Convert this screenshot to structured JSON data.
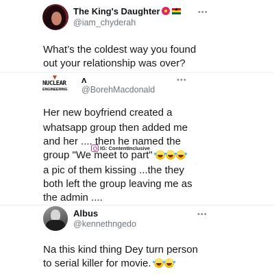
{
  "tweets": [
    {
      "name": "The King's Daughter",
      "handle": "@iam_chyderah",
      "more": "•••",
      "avatar_icon": "profile-photo-woman",
      "name_badges": [
        "flower-emoji",
        "ghana-flag-emoji"
      ],
      "lines": [
        "What’s the coldest way you found",
        "out your relationship was over?"
      ]
    },
    {
      "name": "ʌ",
      "handle": "@BorehMacdonald",
      "more": "•••",
      "avatar_icon": "nuclear-engineering-logo",
      "logo_text": {
        "line1": "NUCLEAR",
        "line2": "ENGINEERING"
      },
      "lines": [
        "Her new boyfriend created a",
        "whatsapp group  then added  me",
        "and her .... then  he named the",
        "group \"We meet to part\"",
        "a pic of them kissing ...the they",
        "both left the group leaving me as",
        "the admin ...."
      ]
    },
    {
      "name": "Albus",
      "handle": "@kennethngedo",
      "more": "•••",
      "avatar_icon": "profile-photo-man",
      "lines": [
        "Na this kind thing Dey turn person",
        "to serial killer for movie."
      ]
    }
  ],
  "watermark": {
    "icon": "instagram-icon",
    "text": "IG: ContentInclusive"
  },
  "colors": {
    "text": "#0f1419",
    "secondary": "#6e767d",
    "divider": "#e6ecf0"
  }
}
